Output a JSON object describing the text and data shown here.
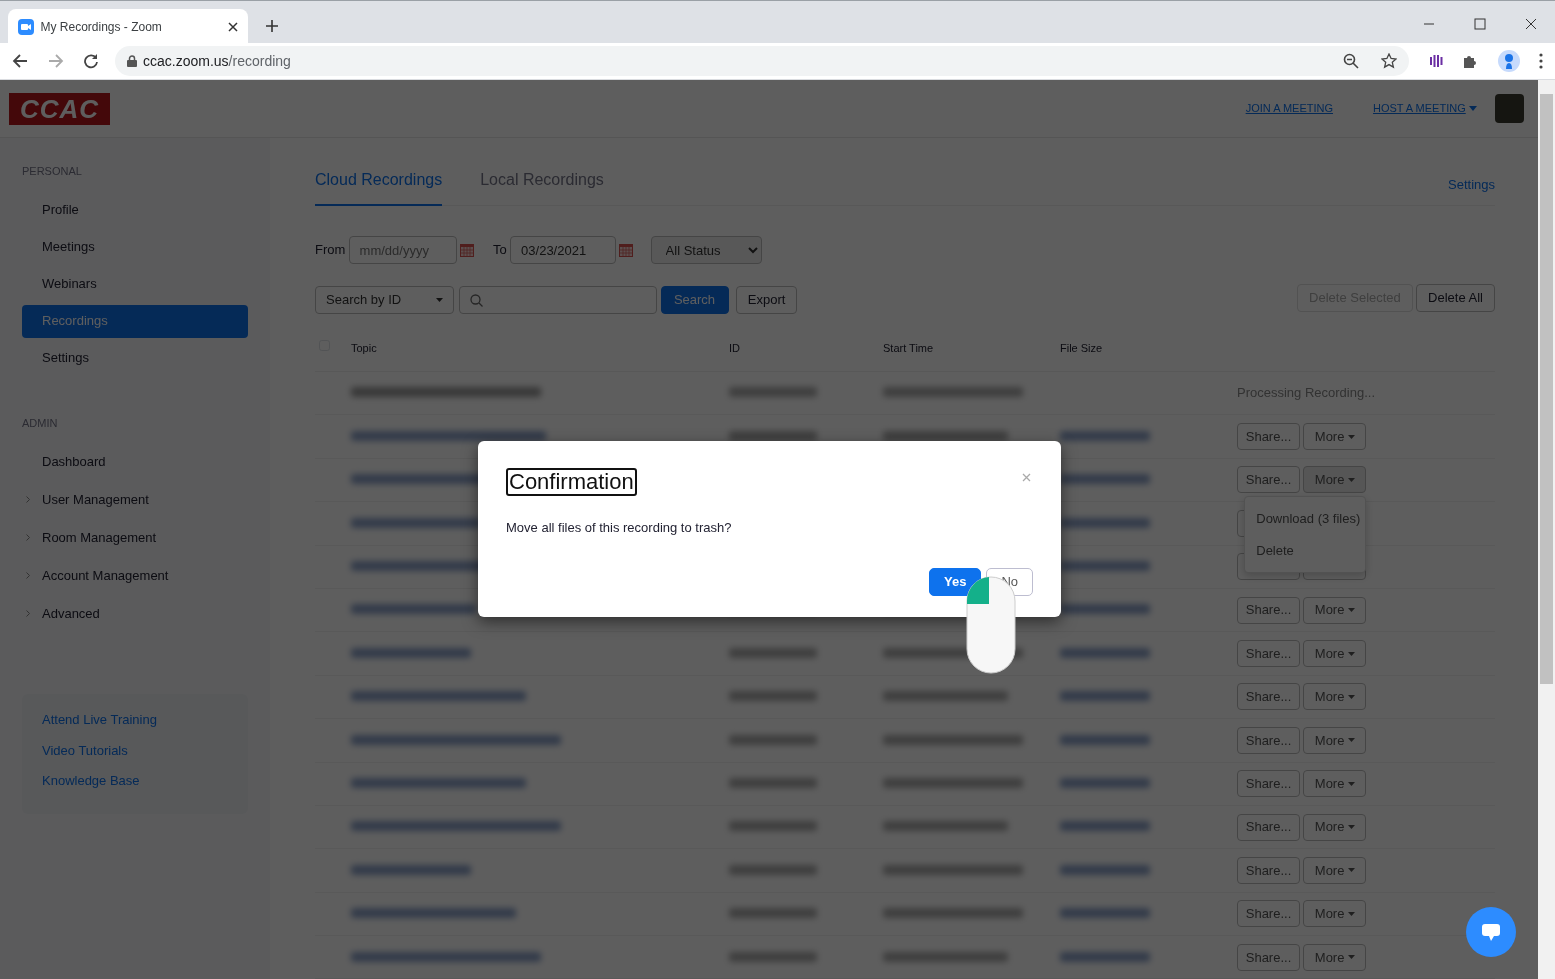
{
  "browser": {
    "tab_title": "My Recordings - Zoom",
    "url_host": "ccac.zoom.us",
    "url_path": "/recording"
  },
  "header": {
    "logo": "CCAC",
    "nav": [
      {
        "label": "JOIN A MEETING",
        "dropdown": false
      },
      {
        "label": "HOST A MEETING",
        "dropdown": true
      }
    ]
  },
  "sidebar": {
    "sections": [
      {
        "heading": "PERSONAL",
        "items": [
          {
            "label": "Profile",
            "selected": false,
            "expandable": false
          },
          {
            "label": "Meetings",
            "selected": false,
            "expandable": false
          },
          {
            "label": "Webinars",
            "selected": false,
            "expandable": false
          },
          {
            "label": "Recordings",
            "selected": true,
            "expandable": false
          },
          {
            "label": "Settings",
            "selected": false,
            "expandable": false
          }
        ]
      },
      {
        "heading": "ADMIN",
        "items": [
          {
            "label": "Dashboard",
            "selected": false,
            "expandable": false
          },
          {
            "label": "User Management",
            "selected": false,
            "expandable": true
          },
          {
            "label": "Room Management",
            "selected": false,
            "expandable": true
          },
          {
            "label": "Account Management",
            "selected": false,
            "expandable": true
          },
          {
            "label": "Advanced",
            "selected": false,
            "expandable": true
          }
        ]
      }
    ],
    "help_links": [
      "Attend Live Training",
      "Video Tutorials",
      "Knowledge Base"
    ]
  },
  "tabs": [
    {
      "label": "Cloud Recordings",
      "selected": true
    },
    {
      "label": "Local Recordings",
      "selected": false
    }
  ],
  "settings_link": "Settings",
  "filters": {
    "from_label": "From",
    "from_placeholder": "mm/dd/yyyy",
    "to_label": "To",
    "to_value": "03/23/2021",
    "status": "All Status",
    "search_by_label": "Search by",
    "search_by_value": "ID",
    "search_button": "Search",
    "export_button": "Export",
    "delete_selected": {
      "label": "Delete Selected",
      "disabled": true
    },
    "delete_all": {
      "label": "Delete All",
      "disabled": false
    }
  },
  "table": {
    "select_all_checked": false,
    "columns": [
      "Topic",
      "ID",
      "Start Time",
      "File Size"
    ],
    "rows": [
      {
        "kind": "processing",
        "status": "Processing Recording..."
      },
      {
        "kind": "actions",
        "share": "Share...",
        "more": "More"
      },
      {
        "kind": "actions",
        "share": "Share...",
        "more": "More",
        "menu": [
          "Download (3 files)",
          "Delete"
        ]
      },
      {
        "kind": "covered"
      },
      {
        "kind": "covered"
      },
      {
        "kind": "actions",
        "share": "Share...",
        "more": "More"
      },
      {
        "kind": "actions",
        "share": "Share...",
        "more": "More"
      },
      {
        "kind": "actions",
        "share": "Share...",
        "more": "More"
      },
      {
        "kind": "actions",
        "share": "Share...",
        "more": "More"
      },
      {
        "kind": "actions",
        "share": "Share...",
        "more": "More"
      },
      {
        "kind": "actions",
        "share": "Share...",
        "more": "More"
      },
      {
        "kind": "actions",
        "share": "Share...",
        "more": "More"
      },
      {
        "kind": "actions",
        "share": "Share...",
        "more": "More"
      },
      {
        "kind": "actions",
        "share": "Share...",
        "more": "More"
      }
    ]
  },
  "dialog": {
    "title": "Confirmation",
    "message": "Move all files of this recording to trash?",
    "buttons": [
      {
        "label": "Yes",
        "kind": "primary"
      },
      {
        "label": "No",
        "kind": "secondary"
      }
    ]
  }
}
